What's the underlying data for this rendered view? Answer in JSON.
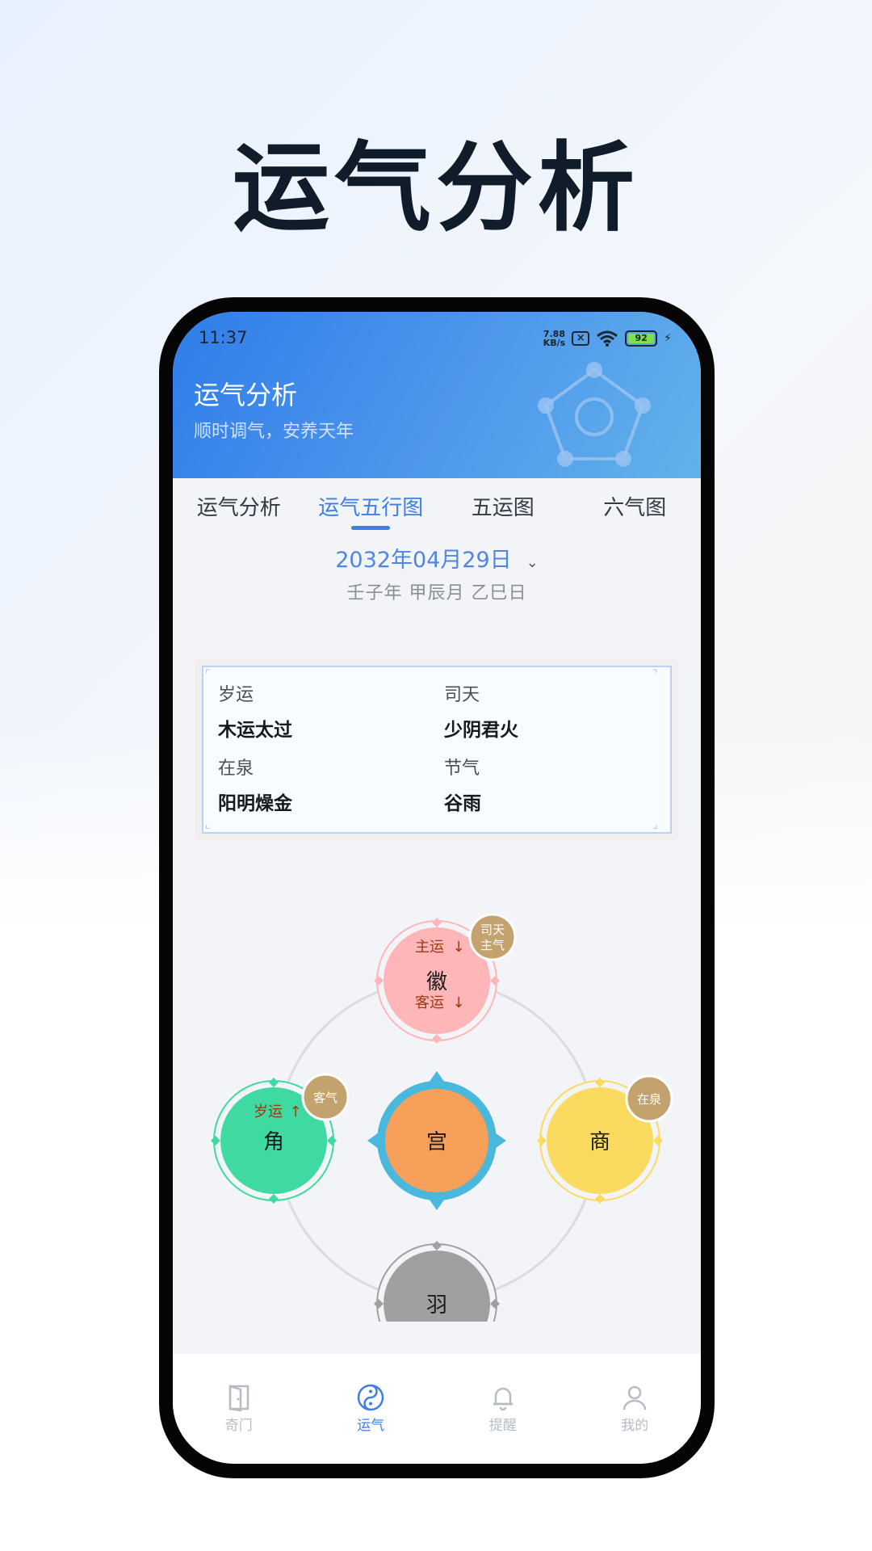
{
  "headline": "运气分析",
  "status_bar": {
    "time": "11:37",
    "net_speed_value": "7.88",
    "net_speed_unit": "KB/s",
    "battery": "92"
  },
  "header": {
    "title": "运气分析",
    "subtitle": "顺时调气，安养天年"
  },
  "tabs": [
    {
      "label": "运气分析",
      "active": false
    },
    {
      "label": "运气五行图",
      "active": true
    },
    {
      "label": "五运图",
      "active": false
    },
    {
      "label": "六气图",
      "active": false
    }
  ],
  "date": {
    "value": "2032年04月29日",
    "ganzhi": "壬子年 甲辰月 乙巳日"
  },
  "info": {
    "suiyun": {
      "label": "岁运",
      "value": "木运太过"
    },
    "sitian": {
      "label": "司天",
      "value": "少阴君火"
    },
    "zaiquan": {
      "label": "在泉",
      "value": "阳明燥金"
    },
    "jieqi": {
      "label": "节气",
      "value": "谷雨"
    }
  },
  "wuxing": {
    "zhi": {
      "name": "徽",
      "top_label": "主运",
      "top_arrow": "↓",
      "bottom_label": "客运",
      "bottom_arrow": "↓",
      "badge_line1": "司天",
      "badge_line2": "主气",
      "color": "#ffb6b9"
    },
    "jiao": {
      "name": "角",
      "top_label": "岁运",
      "top_arrow": "↑",
      "badge": "客气",
      "color": "#3fd9a2"
    },
    "gong": {
      "name": "宫",
      "color": "#f7a05a"
    },
    "shang": {
      "name": "商",
      "badge": "在泉",
      "color": "#fadb5f"
    },
    "yu": {
      "name": "羽",
      "color": "#a0a0a0"
    }
  },
  "bottom_nav": [
    {
      "label": "奇门",
      "icon": "door-icon",
      "active": false
    },
    {
      "label": "运气",
      "icon": "taiji-icon",
      "active": true
    },
    {
      "label": "提醒",
      "icon": "bell-icon",
      "active": false
    },
    {
      "label": "我的",
      "icon": "user-icon",
      "active": false
    }
  ],
  "colors": {
    "accent": "#3d7fe6",
    "badge": "#c4a26e",
    "ring_line": "#dcdcdc",
    "arrow_red": "#9b3a12"
  }
}
